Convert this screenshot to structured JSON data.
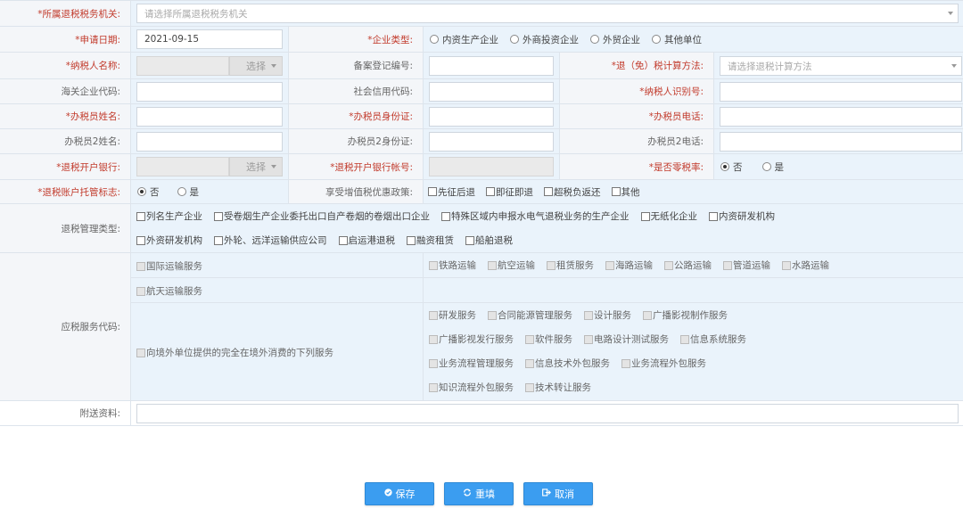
{
  "rows": {
    "tax_authority": {
      "label": "*所属退税税务机关:",
      "placeholder": "请选择所属退税税务机关"
    },
    "apply_date": {
      "label": "*申请日期:",
      "value": "2021-09-15"
    },
    "enterprise_type": {
      "label": "*企业类型:",
      "options": [
        "内资生产企业",
        "外商投资企业",
        "外贸企业",
        "其他单位"
      ]
    },
    "taxpayer_name": {
      "label": "*纳税人名称:",
      "choose": "选择"
    },
    "filing_no": {
      "label": "备案登记编号:"
    },
    "refund_method": {
      "label": "*退（免）税计算方法:",
      "placeholder": "请选择退税计算方法"
    },
    "customs_code": {
      "label": "海关企业代码:"
    },
    "credit_code": {
      "label": "社会信用代码:"
    },
    "taxpayer_id": {
      "label": "*纳税人识别号:"
    },
    "officer_name": {
      "label": "*办税员姓名:"
    },
    "officer_id": {
      "label": "*办税员身份证:"
    },
    "officer_phone": {
      "label": "*办税员电话:"
    },
    "officer2_name": {
      "label": "办税员2姓名:"
    },
    "officer2_id": {
      "label": "办税员2身份证:"
    },
    "officer2_phone": {
      "label": "办税员2电话:"
    },
    "refund_bank": {
      "label": "*退税开户银行:",
      "choose": "选择"
    },
    "refund_account": {
      "label": "*退税开户银行帐号:"
    },
    "zero_rate": {
      "label": "*是否零税率:",
      "options": [
        "否",
        "是"
      ]
    },
    "account_custody": {
      "label": "*退税账户托管标志:",
      "options": [
        "否",
        "是"
      ]
    },
    "vat_policy": {
      "label": "享受增值税优惠政策:",
      "options": [
        "先征后退",
        "即征即退",
        "超税负返还",
        "其他"
      ]
    },
    "mgmt_type": {
      "label": "退税管理类型:",
      "line1": [
        "列名生产企业",
        "受卷烟生产企业委托出口自产卷烟的卷烟出口企业",
        "特殊区域内申报水电气退税业务的生产企业",
        "无纸化企业",
        "内资研发机构"
      ],
      "line2": [
        "外资研发机构",
        "外轮、远洋运输供应公司",
        "启运港退税",
        "融资租赁",
        "船舶退税"
      ]
    },
    "service_code": {
      "label": "应税服务代码:",
      "intl_transport": "国际运输服务",
      "intl_items": [
        "铁路运输",
        "航空运输",
        "租赁服务",
        "海路运输",
        "公路运输",
        "管道运输",
        "水路运输"
      ],
      "space_transport": "航天运输服务",
      "overseas": "向境外单位提供的完全在境外消费的下列服务",
      "overseas_items": [
        [
          "研发服务",
          "合同能源管理服务",
          "设计服务",
          "广播影视制作服务"
        ],
        [
          "广播影视发行服务",
          "软件服务",
          "电路设计测试服务",
          "信息系统服务"
        ],
        [
          "业务流程管理服务",
          "信息技术外包服务",
          "业务流程外包服务"
        ],
        [
          "知识流程外包服务",
          "技术转让服务"
        ]
      ]
    },
    "attachment": {
      "label": "附送资料:"
    }
  },
  "buttons": {
    "save": "保存",
    "reset": "重填",
    "cancel": "取消"
  },
  "colors": {
    "required_label": "#c23b2c",
    "cell_bg": "#eaf3fb",
    "button": "#3b9df0"
  }
}
